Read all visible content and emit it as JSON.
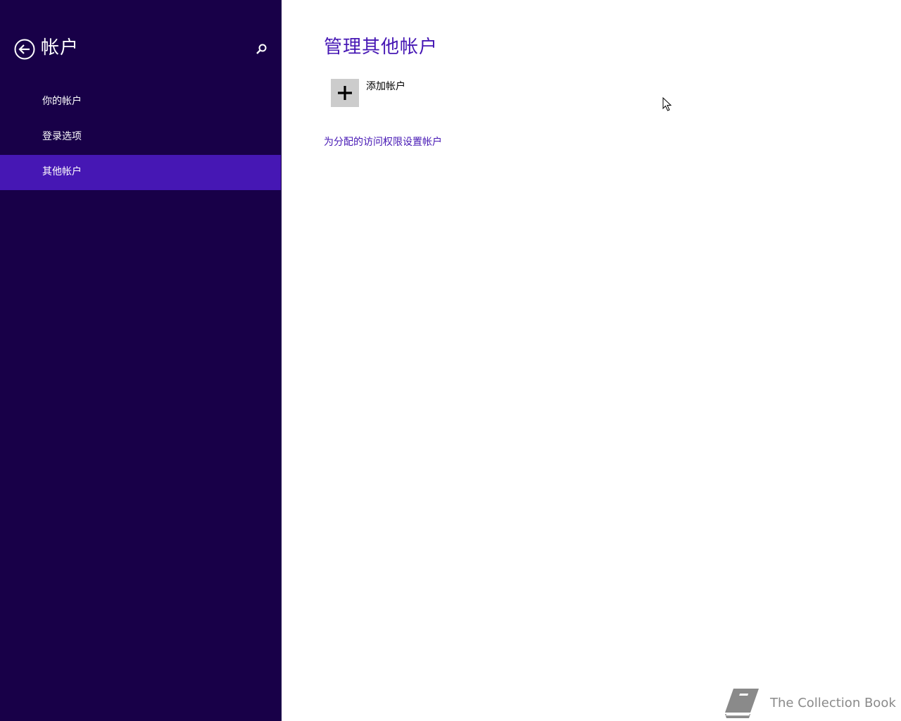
{
  "sidebar": {
    "title": "帐户",
    "items": [
      {
        "label": "你的帐户",
        "selected": false
      },
      {
        "label": "登录选项",
        "selected": false
      },
      {
        "label": "其他帐户",
        "selected": true
      }
    ],
    "icons": {
      "back": "back-arrow-circle-icon",
      "search": "search-icon"
    }
  },
  "main": {
    "title": "管理其他帐户",
    "add_account": {
      "label": "添加帐户",
      "icon": "plus-icon"
    },
    "assigned_access_link": "为分配的访问权限设置帐户"
  },
  "watermark": {
    "text": "The Collection Book",
    "icon": "book-icon"
  },
  "colors": {
    "sidebar_bg": "#180048",
    "selected_item_bg": "#4617b4",
    "accent": "#4617b4",
    "tile_bg": "#cccccc"
  }
}
